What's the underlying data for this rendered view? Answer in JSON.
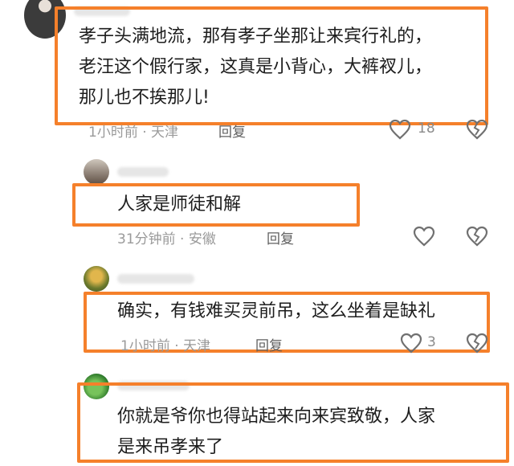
{
  "comments": [
    {
      "lines": [
        "孝子头满地流，那有孝子坐那让来宾行礼的，",
        "老汪这个假行家，这真是小背心，大裤衩儿，",
        "那儿也不挨那儿!"
      ],
      "time": "1小时前",
      "location": "天津",
      "reply": "回复",
      "like_count": "18"
    },
    {
      "lines": [
        "人家是师徒和解"
      ],
      "time": "31分钟前",
      "location": "安徽",
      "reply": "回复",
      "like_count": ""
    },
    {
      "lines": [
        "确实，有钱难买灵前吊，这么坐着是缺礼"
      ],
      "time": "1小时前",
      "location": "天津",
      "reply": "回复",
      "like_count": "3"
    },
    {
      "lines": [
        "你就是爷你也得站起来向来宾致敬，人家",
        "是来吊孝来了"
      ],
      "time": "",
      "location": "",
      "reply": "",
      "like_count": ""
    }
  ],
  "meta_separator": " · ",
  "colors": {
    "highlight_frame": "#f5802b",
    "meta_text": "#9a9a9a",
    "body_text": "#1e1e1e"
  },
  "icons": {
    "like": "heart-outline-icon",
    "dislike": "broken-heart-icon"
  }
}
